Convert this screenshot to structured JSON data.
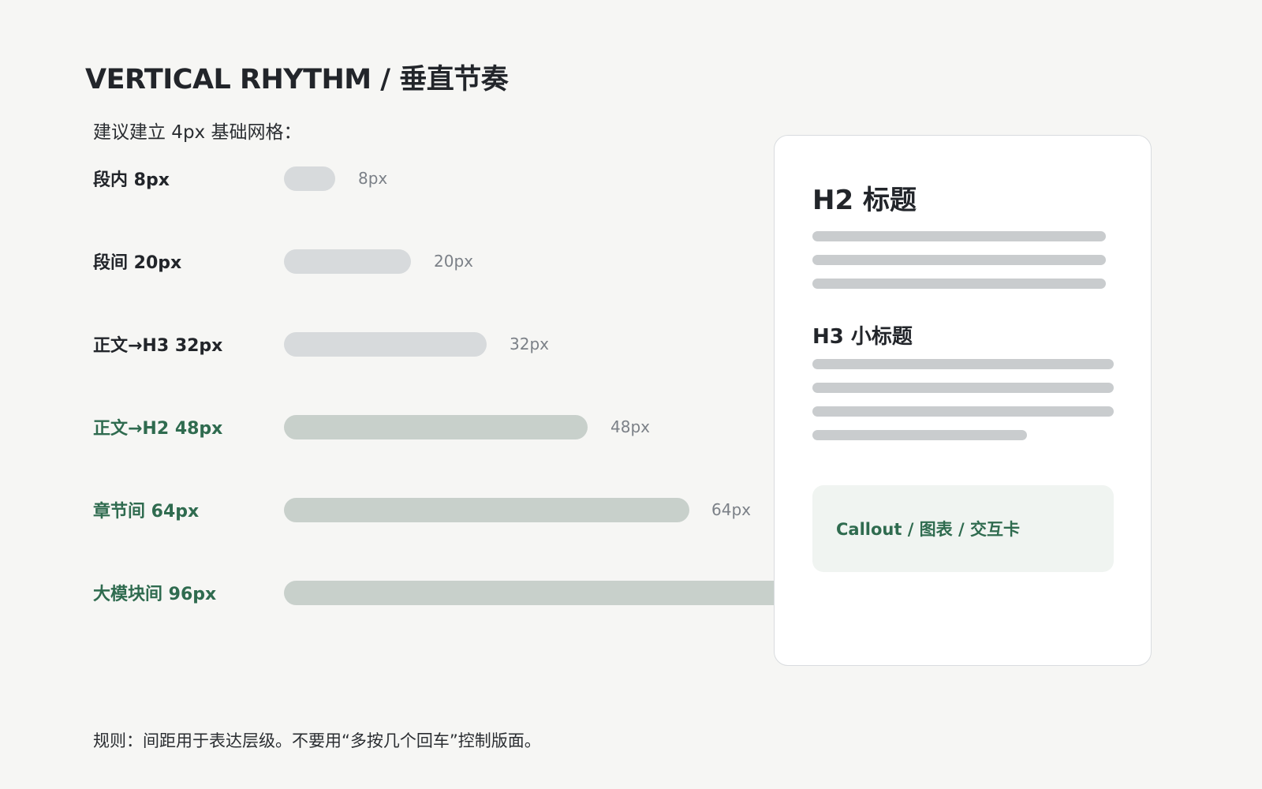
{
  "title": "VERTICAL RHYTHM / 垂直节奏",
  "subtitle": "建议建立 4px 基础网格：",
  "spacing_rows": [
    {
      "label": "段内  8px",
      "value_label": "8px",
      "value": 8,
      "emphasis": false
    },
    {
      "label": "段间  20px",
      "value_label": "20px",
      "value": 20,
      "emphasis": false
    },
    {
      "label": "正文→H3  32px",
      "value_label": "32px",
      "value": 32,
      "emphasis": false
    },
    {
      "label": "正文→H2  48px",
      "value_label": "48px",
      "value": 48,
      "emphasis": true
    },
    {
      "label": "章节间  64px",
      "value_label": "64px",
      "value": 64,
      "emphasis": true
    },
    {
      "label": "大模块间  96px",
      "value_label": "",
      "value": 96,
      "emphasis": true
    }
  ],
  "card": {
    "h2": "H2 标题",
    "h3": "H3 小标题",
    "callout": "Callout / 图表 / 交互卡"
  },
  "rule": "规则：间距用于表达层级。不要用“多按几个回车”控制版面。",
  "colors": {
    "background": "#f6f6f4",
    "text": "#22252a",
    "accent_green": "#2f6b4f",
    "bar_neutral": "#d7dadc",
    "bar_emphasis": "#c8d0cb",
    "value_gray": "#7b8087",
    "card_border": "#d9dcdf",
    "placeholder_line": "#c9ccce",
    "callout_bg": "#f0f4f1"
  }
}
